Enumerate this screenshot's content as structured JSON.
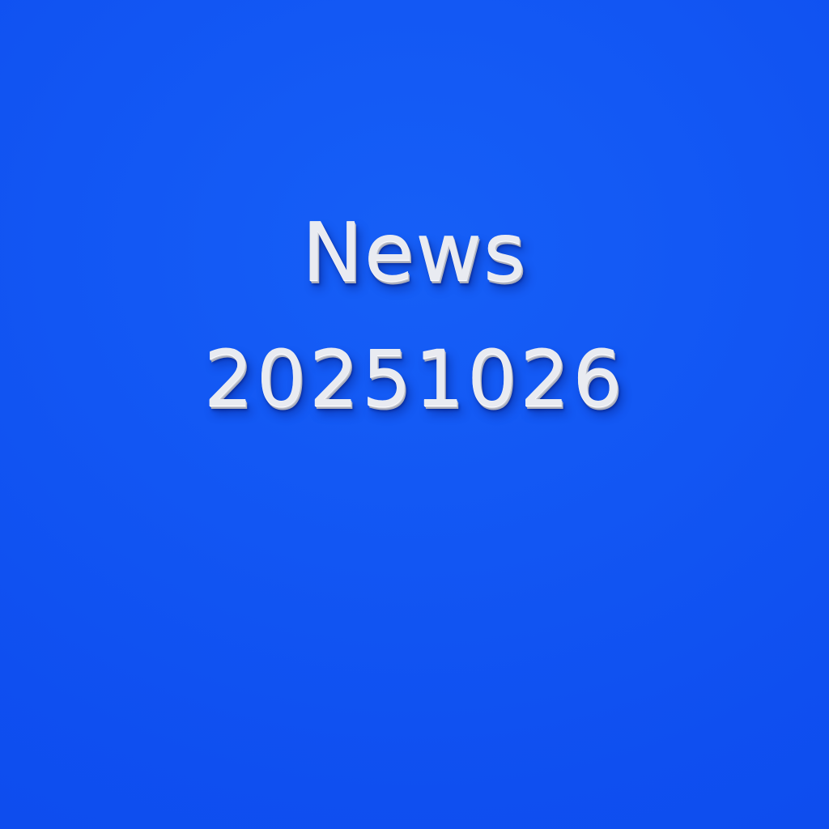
{
  "headline": {
    "line1": "News",
    "line2": "20251026"
  },
  "colors": {
    "background": "#0f4ff0",
    "text": "#e9ebf1"
  }
}
